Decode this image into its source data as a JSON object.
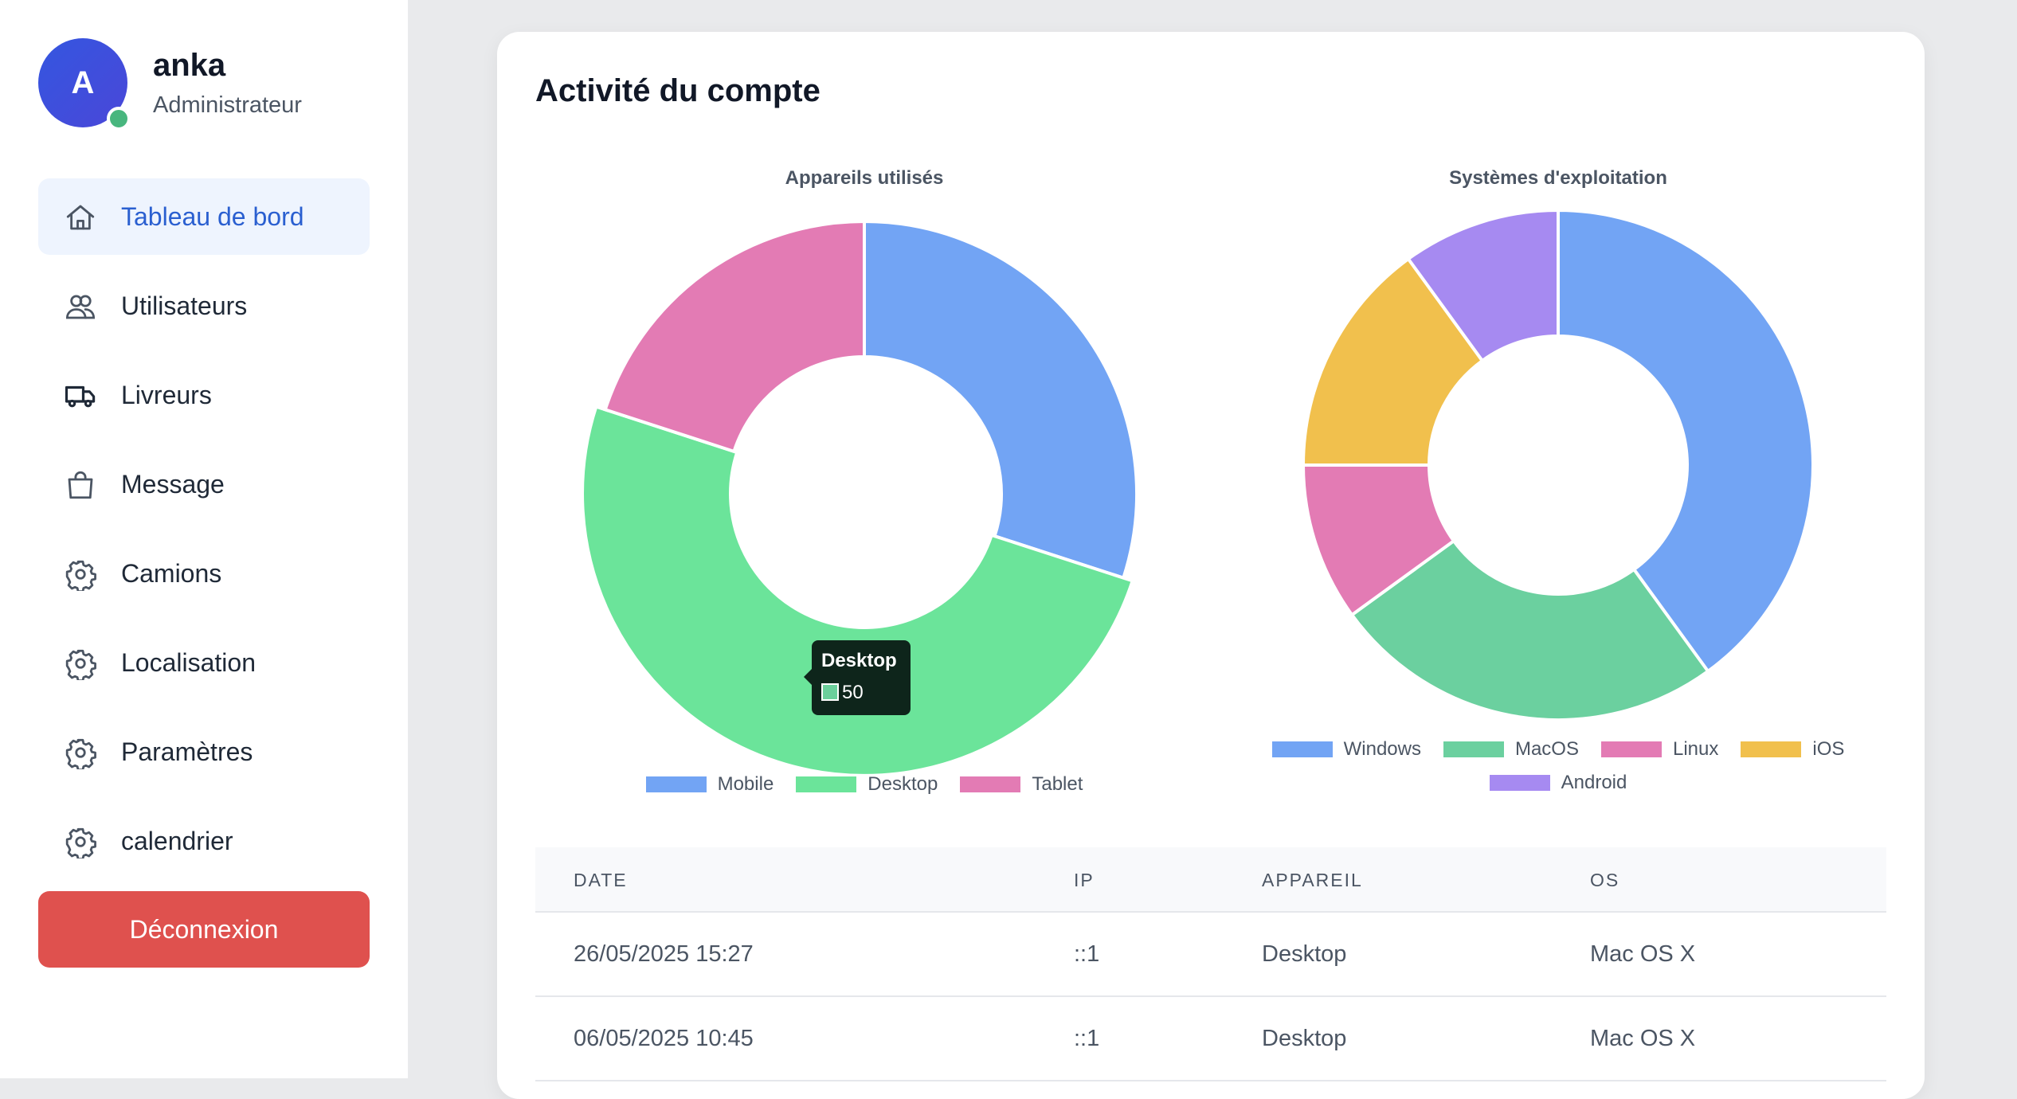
{
  "user": {
    "initial": "A",
    "name": "anka",
    "role": "Administrateur"
  },
  "sidebar": {
    "items": [
      {
        "label": "Tableau de bord",
        "icon": "home-icon",
        "active": true
      },
      {
        "label": "Utilisateurs",
        "icon": "users-icon"
      },
      {
        "label": "Livreurs",
        "icon": "truck-icon"
      },
      {
        "label": "Message",
        "icon": "bag-icon"
      },
      {
        "label": "Camions",
        "icon": "gear-icon"
      },
      {
        "label": "Localisation",
        "icon": "gear-icon"
      },
      {
        "label": "Paramètres",
        "icon": "gear-icon"
      },
      {
        "label": "calendrier",
        "icon": "gear-icon"
      }
    ],
    "logout_label": "Déconnexion"
  },
  "main": {
    "title": "Activité du compte"
  },
  "chart_data": [
    {
      "type": "pie",
      "title": "Appareils utilisés",
      "categories": [
        "Mobile",
        "Desktop",
        "Tablet"
      ],
      "values": [
        30,
        50,
        20
      ],
      "colors": [
        "#72a4f4",
        "#6be49a",
        "#e37bb4"
      ],
      "legend": "bottom",
      "tooltip": {
        "label": "Desktop",
        "value": "50"
      }
    },
    {
      "type": "pie",
      "title": "Systèmes d'exploitation",
      "categories": [
        "Windows",
        "MacOS",
        "Linux",
        "iOS",
        "Android"
      ],
      "values": [
        40,
        25,
        10,
        15,
        10
      ],
      "colors": [
        "#72a4f4",
        "#6bd09f",
        "#e37bb4",
        "#f1c04d",
        "#a68af1"
      ],
      "legend": "bottom"
    }
  ],
  "table": {
    "headers": [
      "DATE",
      "IP",
      "APPAREIL",
      "OS"
    ],
    "rows": [
      [
        "26/05/2025 15:27",
        "::1",
        "Desktop",
        "Mac OS X"
      ],
      [
        "06/05/2025 10:45",
        "::1",
        "Desktop",
        "Mac OS X"
      ]
    ]
  }
}
